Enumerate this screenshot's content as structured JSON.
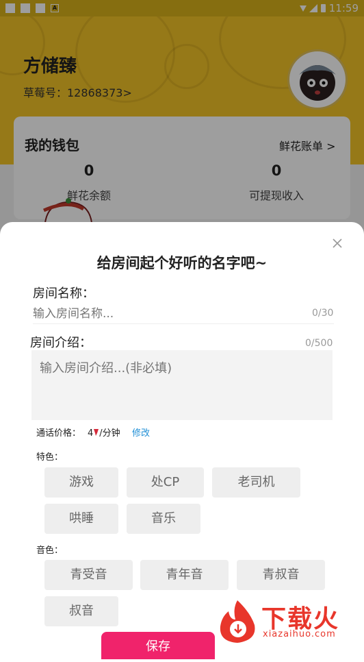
{
  "status_bar": {
    "time": "11:59",
    "notice_icon": "A"
  },
  "profile": {
    "name": "方储臻",
    "id_label": "草莓号：12868373>"
  },
  "wallet": {
    "title": "我的钱包",
    "bill_link": "鲜花账单 >",
    "stats": [
      {
        "value": "0",
        "label": "鲜花余额"
      },
      {
        "value": "0",
        "label": "可提现收入"
      }
    ]
  },
  "sheet": {
    "title": "给房间起个好听的名字吧~",
    "room_name_label": "房间名称：",
    "room_name_placeholder": "输入房间名称...",
    "room_name_counter": "0/30",
    "room_intro_label": "房间介绍：",
    "room_intro_counter": "0/500",
    "room_intro_placeholder": "输入房间介绍...(非必填)",
    "price_label": "通话价格：",
    "price_value": "4",
    "price_unit": "/分钟",
    "edit_label": "修改",
    "features_label": "特色：",
    "features": [
      "游戏",
      "处CP",
      "老司机",
      "哄睡",
      "音乐"
    ],
    "voice_label": "音色：",
    "voices": [
      "青受音",
      "青年音",
      "青叔音",
      "叔音"
    ],
    "save_label": "保存"
  },
  "watermark": {
    "text": "下载火",
    "sub": "xiazaihuo.com"
  },
  "colors": {
    "header": "#f3c327",
    "accent": "#f0236b",
    "link": "#1f8fd6"
  }
}
